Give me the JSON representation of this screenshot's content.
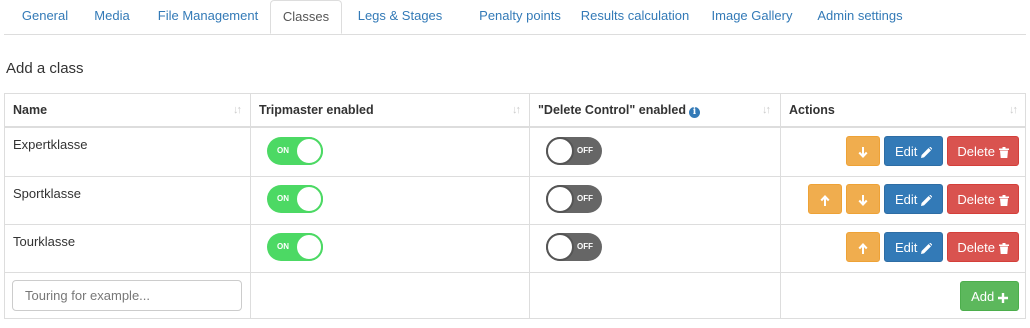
{
  "tabs": [
    {
      "label": "General"
    },
    {
      "label": "Media"
    },
    {
      "label": "File Management"
    },
    {
      "label": "Classes"
    },
    {
      "label": "Legs & Stages"
    },
    {
      "label": "Penalty points"
    },
    {
      "label": "Results calculation"
    },
    {
      "label": "Image Gallery"
    },
    {
      "label": "Admin settings"
    }
  ],
  "active_tab": "Classes",
  "heading": "Add a class",
  "table": {
    "headers": {
      "name": "Name",
      "tripmaster": "Tripmaster enabled",
      "delete_control": "\"Delete Control\" enabled",
      "actions": "Actions"
    },
    "rows": [
      {
        "name": "Expertklasse",
        "tripmaster": "ON",
        "delete_control": "OFF"
      },
      {
        "name": "Sportklasse",
        "tripmaster": "ON",
        "delete_control": "OFF"
      },
      {
        "name": "Tourklasse",
        "tripmaster": "ON",
        "delete_control": "OFF"
      }
    ]
  },
  "buttons": {
    "edit": "Edit",
    "delete": "Delete",
    "add": "Add"
  },
  "new_class_input": {
    "placeholder": "Touring for example...",
    "value": ""
  },
  "icons": {
    "up": "arrow-up-icon",
    "down": "arrow-down-icon",
    "edit": "pencil-icon",
    "delete": "trash-icon",
    "add": "plus-icon",
    "info": "info-icon",
    "sort": "sort-icon"
  },
  "colors": {
    "link": "#337ab7",
    "toggle_on": "#4cd964",
    "toggle_off": "#666666",
    "warning": "#f0ad4e",
    "primary": "#337ab7",
    "danger": "#d9534f",
    "success": "#5cb85c"
  }
}
